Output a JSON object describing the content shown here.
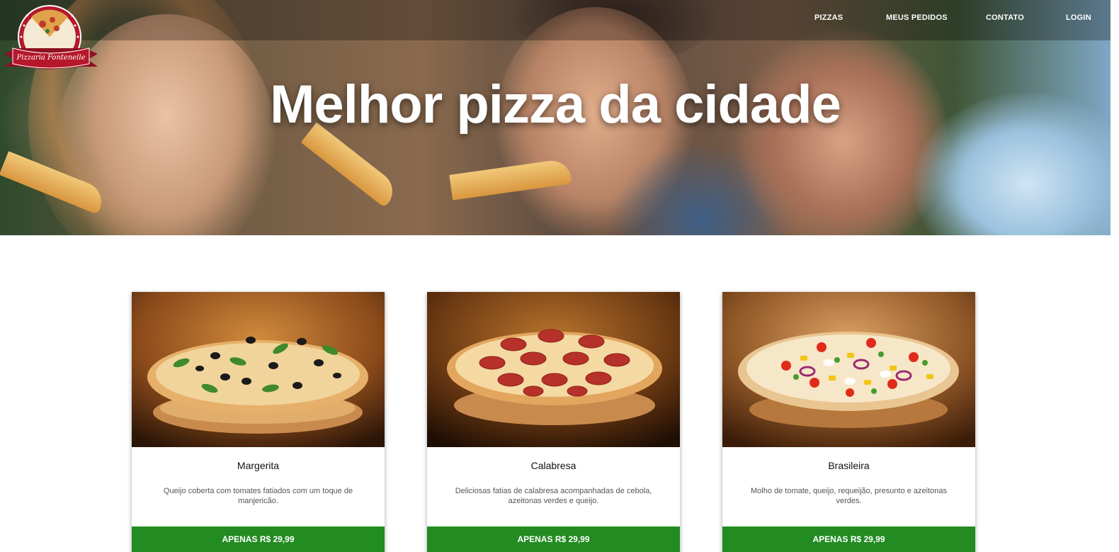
{
  "brand": {
    "logo_text": "Pizzaria Fontenelle"
  },
  "nav": {
    "items": [
      {
        "label": "PIZZAS"
      },
      {
        "label": "MEUS PEDIDOS"
      },
      {
        "label": "CONTATO"
      },
      {
        "label": "LOGIN"
      }
    ]
  },
  "hero": {
    "title": "Melhor pizza da cidade"
  },
  "pizzas": [
    {
      "name": "Margerita",
      "description": "Queijo coberta com tomates fatiados com um toque de manjericão.",
      "price_label": "APENAS R$ 29,99",
      "topping": "olive-basil"
    },
    {
      "name": "Calabresa",
      "description": "Deliciosas fatias de calabresa acompanhadas de cebola, azeitonas verdes e queijo.",
      "price_label": "APENAS R$ 29,99",
      "topping": "pepperoni"
    },
    {
      "name": "Brasileira",
      "description": "Molho de tomate, queijo, requeijão, presunto e azeitonas verdes.",
      "price_label": "APENAS R$ 29,99",
      "topping": "peppers-onion"
    }
  ],
  "colors": {
    "accent_green": "#228b22",
    "logo_red": "#b5172b",
    "text_dark": "#111111",
    "text_muted": "#555555"
  }
}
